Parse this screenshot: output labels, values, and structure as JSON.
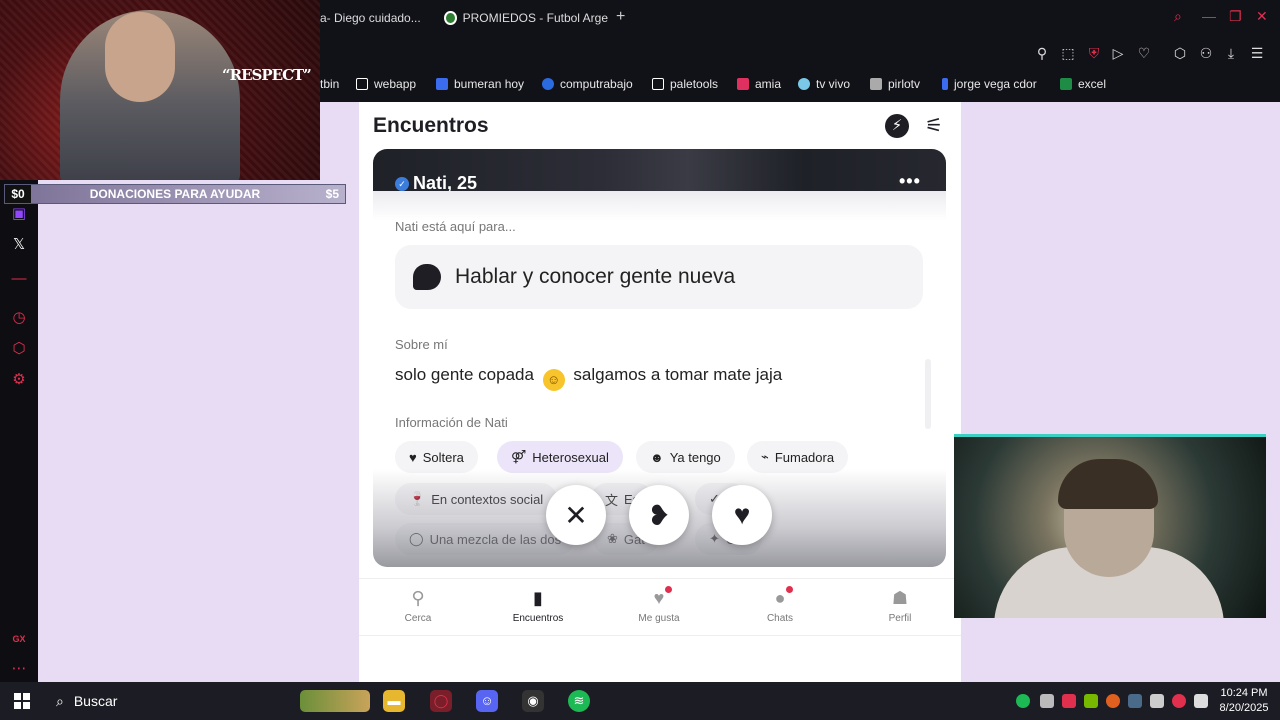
{
  "browser": {
    "tabs": [
      {
        "label": "a- Diego cuidado..."
      },
      {
        "label": "PROMIEDOS - Futbol Arge"
      }
    ],
    "new_tab_symbol": "+"
  },
  "bookmarks": [
    {
      "label": "tbin"
    },
    {
      "label": "webapp",
      "color": "#ffffff"
    },
    {
      "label": "bumeran hoy",
      "color": "#3b6cf0"
    },
    {
      "label": "computrabajo",
      "color": "#2b6be0"
    },
    {
      "label": "paletools",
      "color": "#ffffff"
    },
    {
      "label": "amia",
      "color": "#e03060"
    },
    {
      "label": "tv vivo",
      "color": "#7ac7e8"
    },
    {
      "label": "pirlotv",
      "color": "#aaaaaa"
    },
    {
      "label": "jorge vega cdor",
      "color": "#3b6cf0"
    },
    {
      "label": "excel",
      "color": "#1e8c45"
    }
  ],
  "stream_overlay": {
    "respect_text": "“RESPECT”",
    "donation": {
      "left": "$0",
      "label": "DONACIONES PARA AYUDAR",
      "right": "$5"
    }
  },
  "app": {
    "title": "Encuentros",
    "profile": {
      "name": "Nati, 25",
      "purpose_heading": "Nati está aquí para...",
      "purpose": "Hablar y conocer gente nueva",
      "about_heading": "Sobre mí",
      "about_before": "solo gente copada",
      "about_after": "salgamos a tomar mate jaja",
      "info_heading": "Información de Nati",
      "chips_row1": [
        "Soltera",
        "Heterosexual",
        "Ya tengo",
        "Fumadora"
      ],
      "chips_row2": [
        "En contextos social",
        "Es",
        "n"
      ],
      "chips_row3": [
        "Una mezcla de las dos",
        "Gat",
        "Gra"
      ]
    },
    "nav": [
      {
        "label": "Cerca"
      },
      {
        "label": "Encuentros"
      },
      {
        "label": "Me gusta"
      },
      {
        "label": "Chats"
      },
      {
        "label": "Perfil"
      }
    ]
  },
  "taskbar": {
    "search_label": "Buscar",
    "time": "10:24 PM",
    "date": "8/20/2025"
  },
  "colors": {
    "accent": "#e0304e",
    "page_bg": "#e8dcf5",
    "chip_active": "#ece4f8"
  }
}
